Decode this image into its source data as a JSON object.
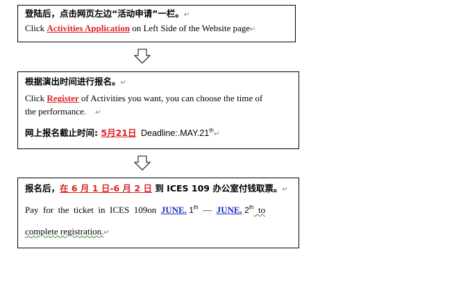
{
  "step1": {
    "cn_text": "登陆后，点击网页左边“活动申请”一栏。",
    "en_prefix": "Click ",
    "en_link": "Activities Application",
    "en_suffix": " on Left Side of the Website page"
  },
  "step2": {
    "cn_title": "根据演出时间进行报名。",
    "en_prefix": "Click ",
    "en_link": "Register",
    "en_line1_suffix": " of Activities you want, you can choose the time of",
    "en_line2": "the performance.",
    "deadline_cn_label": "网上报名截止时间",
    "deadline_colon": ": ",
    "deadline_cn_date": "5月21日",
    "deadline_en": "Deadline:.MAY.21",
    "deadline_en_sup": "th"
  },
  "step3": {
    "cn_prefix": "报名后，",
    "cn_date_range": "在 6 月 1 日-6 月 2 日",
    "cn_suffix": "到 ICES 109 办公室付钱取票。",
    "en_prefix": "Pay  for  the  ticket  in  ICES  109on  ",
    "month1": "JUNE.",
    "day1": " 1",
    "day1_sup": "th",
    "dash": "  —  ",
    "month2": "JUNE.",
    "day2": " 2",
    "day2_sup": "th",
    "en_to": "  to",
    "en_line2": "complete registration."
  },
  "marks": {
    "paragraph_mark": "↵"
  }
}
